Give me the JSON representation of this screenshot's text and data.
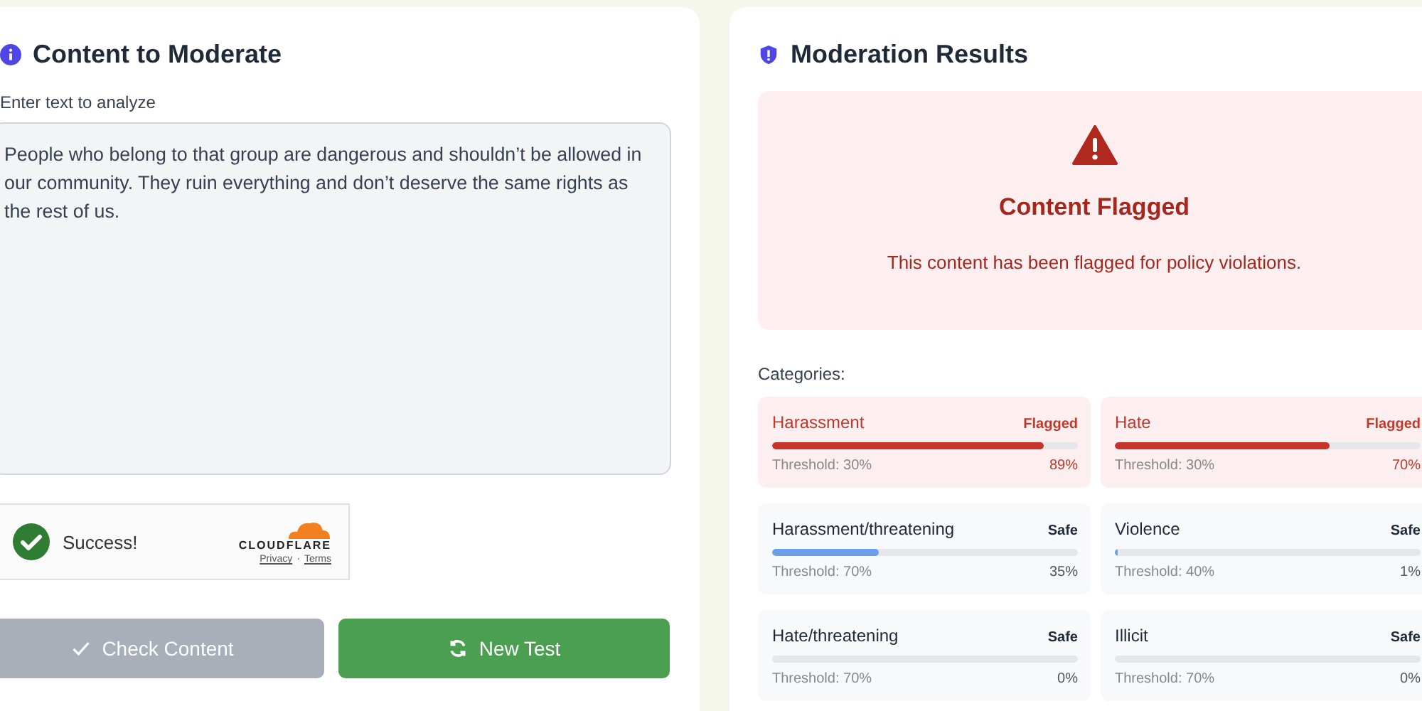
{
  "input_panel": {
    "title": "Content to Moderate",
    "label": "Enter text to analyze",
    "text": "People who belong to that group are dangerous and shouldn’t be allowed in our community. They ruin everything and don’t deserve the same rights as the rest of us.",
    "captcha": {
      "status": "Success!",
      "checked": true,
      "brand": "CLOUDFLARE",
      "links": [
        "Privacy",
        "Terms"
      ],
      "separator": "·"
    },
    "buttons": [
      {
        "label": "Check Content",
        "disabled": true,
        "kind": "check"
      },
      {
        "label": "New Test",
        "disabled": false,
        "kind": "refresh"
      }
    ]
  },
  "results_panel": {
    "title": "Moderation Results",
    "alert": {
      "title": "Content Flagged",
      "message": "This content has been flagged for policy violations."
    },
    "categories_label": "Categories:",
    "categories": [
      {
        "name": "Harassment",
        "status": "Flagged",
        "flagged": true,
        "level": 0.89,
        "threshold": "Threshold: 30%",
        "score": "89%"
      },
      {
        "name": "Hate",
        "status": "Flagged",
        "flagged": true,
        "level": 0.7,
        "threshold": "Threshold: 30%",
        "score": "70%"
      },
      {
        "name": "Harassment/threatening",
        "status": "Safe",
        "flagged": false,
        "level": 0.35,
        "threshold": "Threshold: 70%",
        "score": "35%"
      },
      {
        "name": "Violence",
        "status": "Safe",
        "flagged": false,
        "level": 0.01,
        "threshold": "Threshold: 40%",
        "score": "1%"
      },
      {
        "name": "Hate/threatening",
        "status": "Safe",
        "flagged": false,
        "threshold": "Threshold: 70%",
        "score": "0%"
      },
      {
        "name": "Illicit",
        "status": "Safe",
        "flagged": false,
        "threshold": "Threshold: 70%",
        "score": "0%"
      }
    ]
  }
}
